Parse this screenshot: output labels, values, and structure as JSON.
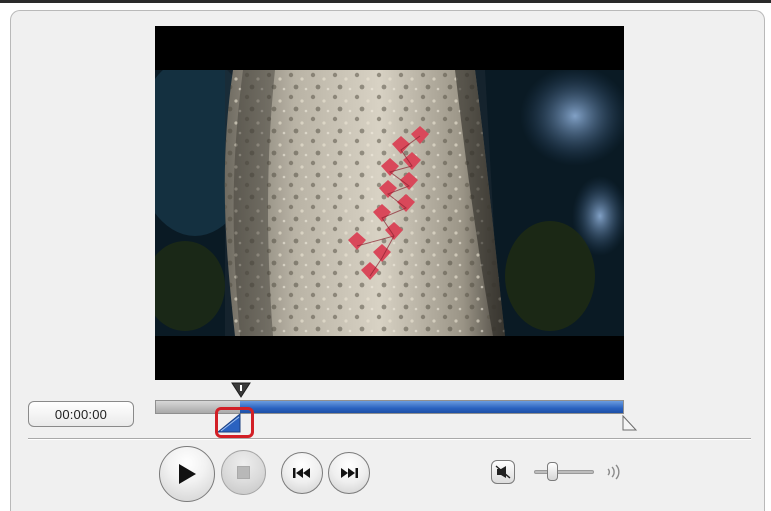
{
  "player": {
    "timecode": "00:00:00",
    "playback_position": 0.18,
    "selection_start": 0.18,
    "selection_end": 1.0,
    "volume_level": 0.3
  },
  "icons": {
    "play": "play-icon",
    "stop": "stop-icon",
    "previous": "skip-previous-icon",
    "next": "skip-next-icon",
    "mute": "speaker-mute-icon",
    "volume_max": "speaker-loud-icon",
    "playhead": "playhead-marker-icon",
    "trim_start": "trim-start-handle-icon",
    "trim_end": "trim-end-handle-icon"
  },
  "colors": {
    "selection_blue": "#2a62c0",
    "highlight_red": "#d21f26",
    "window_bg": "#f0f0f0"
  }
}
